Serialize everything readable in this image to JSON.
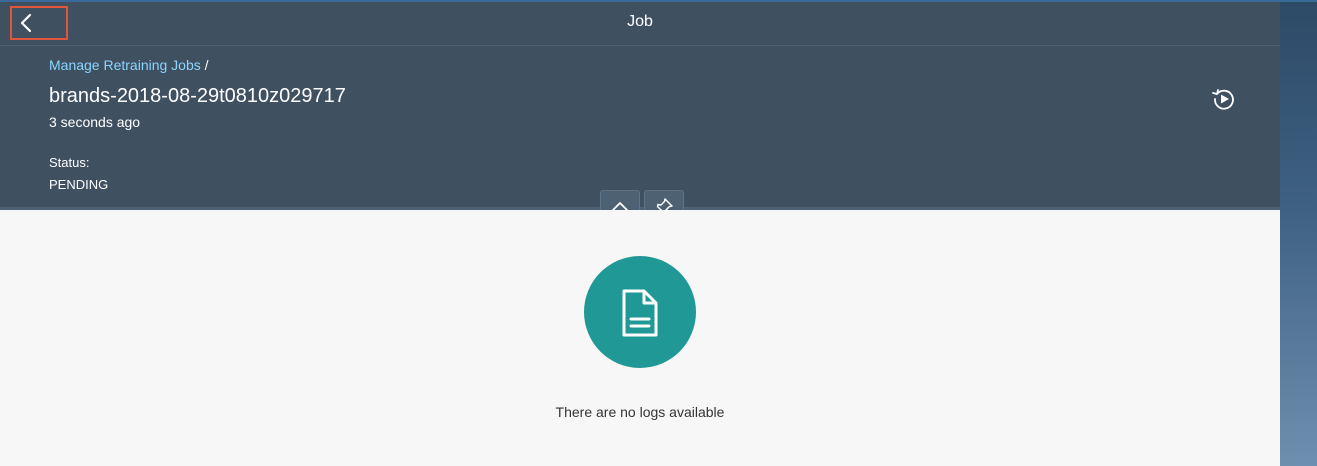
{
  "shell": {
    "title": "Job",
    "back_icon": "chevron-left-icon"
  },
  "breadcrumb": {
    "link": "Manage Retraining Jobs",
    "separator": " /"
  },
  "job": {
    "name": "brands-2018-08-29t0810z029717",
    "time": "3 seconds ago",
    "status_label": "Status:",
    "status_value": "PENDING"
  },
  "actions": {
    "rerun_icon": "restart-icon",
    "collapse_icon": "chevron-up-icon",
    "pin_icon": "pin-icon"
  },
  "empty_state": {
    "icon": "document-icon",
    "message": "There are no logs available"
  },
  "colors": {
    "shell_bg": "#3f5060",
    "link": "#8bd4ff",
    "accent_teal": "#1f9896",
    "highlight_border": "#e0553c"
  }
}
